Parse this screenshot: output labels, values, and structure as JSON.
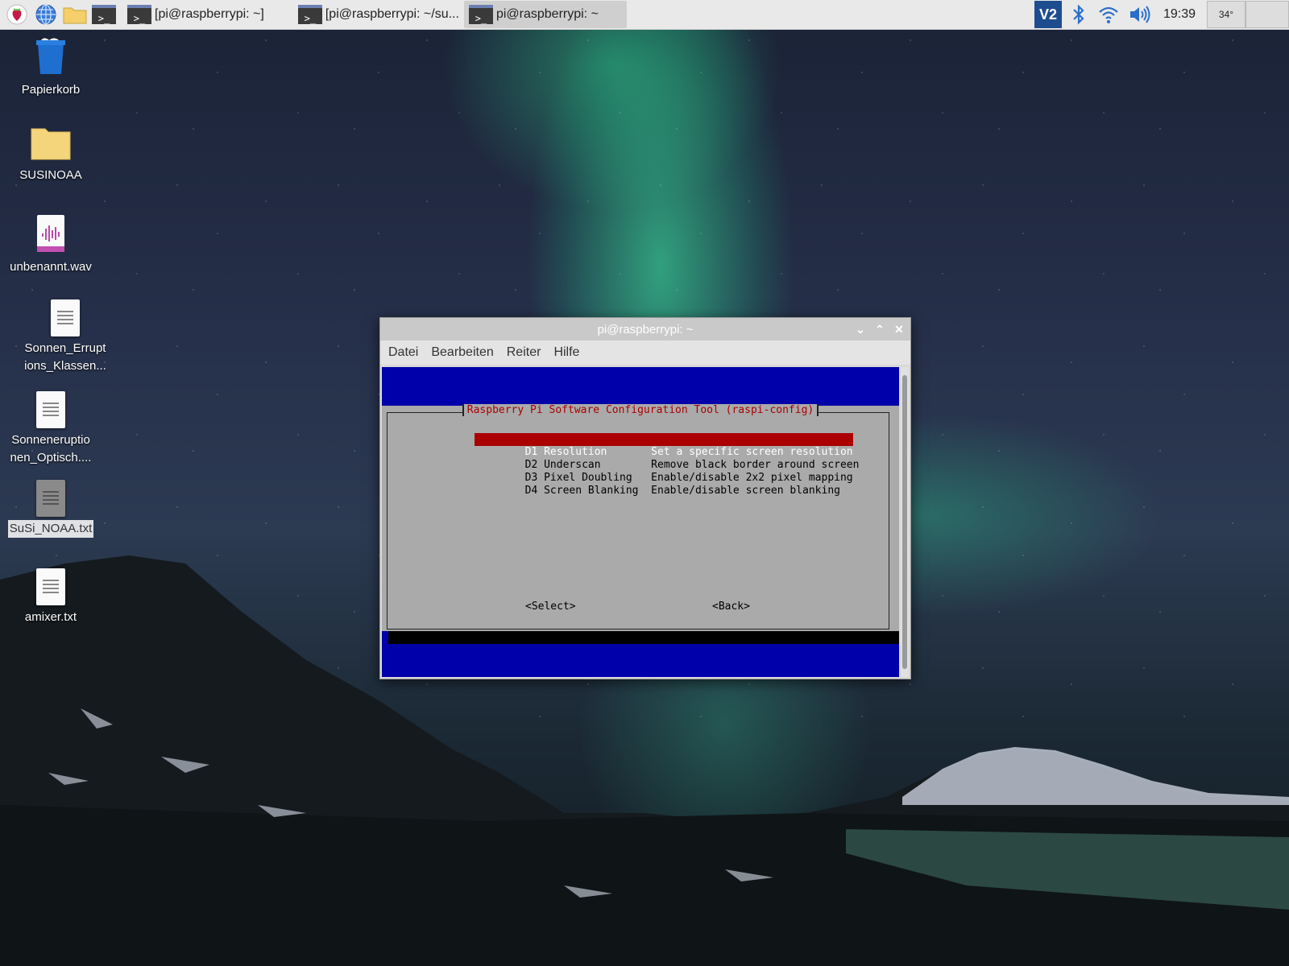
{
  "taskbar": {
    "tasks": [
      {
        "label": "[pi@raspberrypi: ~]"
      },
      {
        "label": "[pi@raspberrypi: ~/su..."
      },
      {
        "label": "pi@raspberrypi: ~"
      }
    ],
    "clock": "19:39",
    "cpu_temp": "34°"
  },
  "desktop": {
    "icons": [
      {
        "label": "Papierkorb"
      },
      {
        "label": "SUSINOAA"
      },
      {
        "label": "unbenannt.wav"
      },
      {
        "label": "Sonnen_Erruptions_Klassen..."
      },
      {
        "label": "Sonneneruptionen_Optisch...."
      },
      {
        "label": "SuSi_NOAA.txt"
      },
      {
        "label": "amixer.txt"
      }
    ]
  },
  "window": {
    "title": "pi@raspberrypi: ~",
    "menu": [
      "Datei",
      "Bearbeiten",
      "Reiter",
      "Hilfe"
    ],
    "dialog": {
      "title": "Raspberry Pi Software Configuration Tool (raspi-config)",
      "items": [
        {
          "key": "D1 Resolution     ",
          "desc": "Set a specific screen resolution"
        },
        {
          "key": "D2 Underscan      ",
          "desc": "Remove black border around screen"
        },
        {
          "key": "D3 Pixel Doubling ",
          "desc": "Enable/disable 2x2 pixel mapping"
        },
        {
          "key": "D4 Screen Blanking",
          "desc": "Enable/disable screen blanking"
        }
      ],
      "select_label": "<Select>",
      "back_label": "<Back>"
    }
  }
}
